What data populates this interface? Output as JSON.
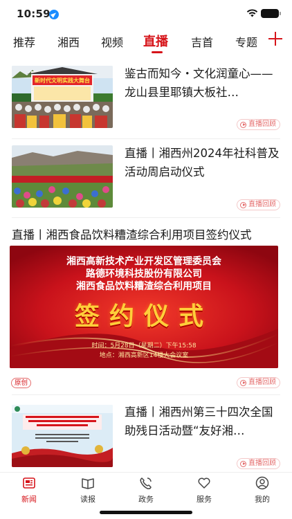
{
  "status_bar": {
    "time": "10:59"
  },
  "tabs": [
    {
      "label": "推荐"
    },
    {
      "label": "湘西"
    },
    {
      "label": "视频"
    },
    {
      "label": "直播"
    },
    {
      "label": "吉首"
    },
    {
      "label": "专题"
    }
  ],
  "colors": {
    "accent": "#d6141a",
    "replay": "#e46b6b"
  },
  "feed": [
    {
      "title": "鉴古而知今・文化润童心——龙山县里耶镇大板社区",
      "title_display": "鉴古而知今・文化润童心——龙山县里耶镇大板社…",
      "thumb_caption": "新时代文明实践大舞台",
      "badge": "直播回顾"
    },
    {
      "title": "直播丨湘西州2024年社科普及活动周启动仪式",
      "badge": "直播回顾"
    },
    {
      "title": "直播丨湘西食品饮料糟渣综合利用项目签约仪式",
      "banner": {
        "line1": "湘西高新技术产业开发区管理委员会",
        "line2": "路德环境科技股份有限公司",
        "line3": "湘西食品饮料糟渣综合利用项目",
        "main": "签约仪式",
        "time": "时间：5月28日（星期二）下午15:58",
        "place": "地点：湘西高新区14楼大会议室"
      },
      "tag": "原创",
      "badge": "直播回顾"
    },
    {
      "title": "直播丨湘西州第三十四次全国助残日活动暨“友好湘西”",
      "title_display": "直播丨湘西州第三十四次全国助残日活动暨“友好湘…",
      "badge": "直播回顾"
    }
  ],
  "bottom_nav": [
    {
      "label": "新闻",
      "icon": "news-icon"
    },
    {
      "label": "读报",
      "icon": "newspaper-icon"
    },
    {
      "label": "政务",
      "icon": "government-icon"
    },
    {
      "label": "服务",
      "icon": "heart-icon"
    },
    {
      "label": "我的",
      "icon": "user-icon"
    }
  ]
}
